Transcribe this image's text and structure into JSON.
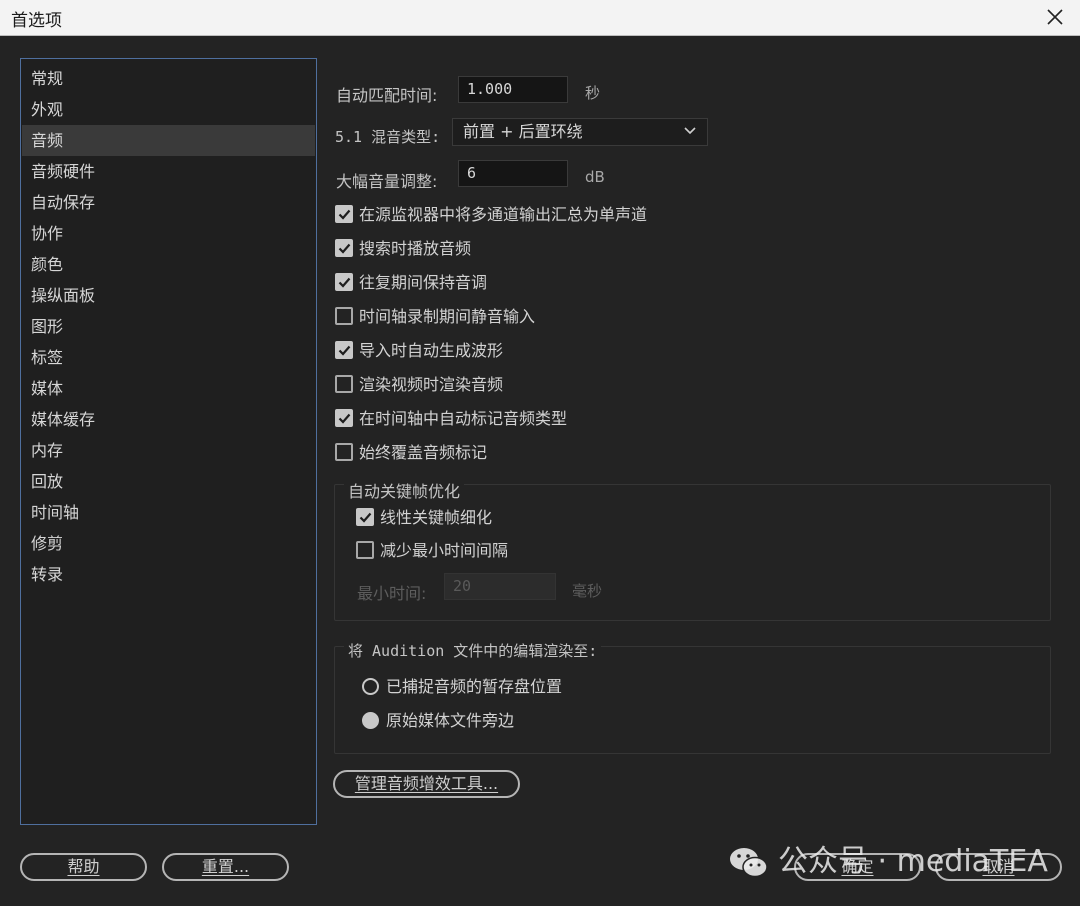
{
  "window": {
    "title": "首选项"
  },
  "sidebar": {
    "items": [
      {
        "label": "常规"
      },
      {
        "label": "外观"
      },
      {
        "label": "音频",
        "active": true
      },
      {
        "label": "音频硬件"
      },
      {
        "label": "自动保存"
      },
      {
        "label": "协作"
      },
      {
        "label": "颜色"
      },
      {
        "label": "操纵面板"
      },
      {
        "label": "图形"
      },
      {
        "label": "标签"
      },
      {
        "label": "媒体"
      },
      {
        "label": "媒体缓存"
      },
      {
        "label": "内存"
      },
      {
        "label": "回放"
      },
      {
        "label": "时间轴"
      },
      {
        "label": "修剪"
      },
      {
        "label": "转录"
      }
    ]
  },
  "audio": {
    "auto_match": {
      "label": "自动匹配时间:",
      "value": "1.000",
      "unit": "秒"
    },
    "mix_type": {
      "label": "5.1 混音类型:",
      "selected": "前置 + 后置环绕"
    },
    "large_volume": {
      "label": "大幅音量调整:",
      "value": "6",
      "unit": "dB"
    },
    "checkboxes": [
      {
        "label": "在源监视器中将多通道输出汇总为单声道",
        "checked": true
      },
      {
        "label": "搜索时播放音频",
        "checked": true
      },
      {
        "label": "往复期间保持音调",
        "checked": true
      },
      {
        "label": "时间轴录制期间静音输入",
        "checked": false
      },
      {
        "label": "导入时自动生成波形",
        "checked": true
      },
      {
        "label": "渲染视频时渲染音频",
        "checked": false
      },
      {
        "label": "在时间轴中自动标记音频类型",
        "checked": true
      },
      {
        "label": "始终覆盖音频标记",
        "checked": false
      }
    ],
    "keyframe_group": {
      "title": "自动关键帧优化",
      "linear": {
        "label": "线性关键帧细化",
        "checked": true
      },
      "reduce": {
        "label": "减少最小时间间隔",
        "checked": false
      },
      "min_time": {
        "label": "最小时间:",
        "value": "20",
        "unit": "毫秒"
      }
    },
    "audition_group": {
      "title": "将 Audition 文件中的编辑渲染至:",
      "options": [
        {
          "label": "已捕捉音频的暂存盘位置",
          "selected": false
        },
        {
          "label": "原始媒体文件旁边",
          "selected": true
        }
      ]
    },
    "manage_button": "管理音频增效工具..."
  },
  "footer": {
    "help": "帮助",
    "reset": "重置...",
    "ok": "确定",
    "cancel": "取消"
  },
  "watermark": {
    "text": "公众号 · mediaTEA"
  },
  "icons": {
    "close": "close-icon",
    "chevron": "chevron-down-icon",
    "check": "checkmark-icon",
    "wechat": "wechat-icon"
  },
  "colors": {
    "background": "#232323",
    "sidebar_border": "#4f6f9e",
    "active_item": "#3a3a3a"
  }
}
